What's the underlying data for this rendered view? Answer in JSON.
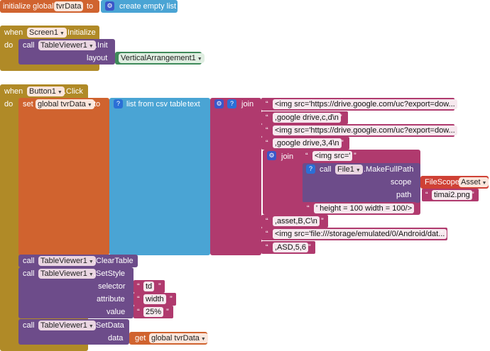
{
  "colors": {
    "global_orange": "#d0632f",
    "event_gold": "#b08a27",
    "list_blue": "#4aa4d4",
    "text_magenta": "#b03a6e",
    "component_purple": "#6d4c8a",
    "layout_green": "#3f8a5a"
  },
  "init_global": {
    "label": "initialize global",
    "name": "tvrData",
    "to": "to",
    "value_label": "create empty list"
  },
  "screen_init": {
    "when": "when",
    "component": "Screen1",
    "event": ".Initialize",
    "do": "do",
    "call": "call",
    "viewer": "TableViewer1",
    "method": ".Init",
    "layout_label": "layout",
    "layout_value": "VerticalArrangement1"
  },
  "button_click": {
    "when": "when",
    "component": "Button1",
    "event": ".Click",
    "do": "do",
    "set": "set",
    "var": "global tvrData",
    "to": "to",
    "list_from_csv": "list from csv table",
    "text": "text",
    "join": "join",
    "strings": [
      "<img src='https://drive.google.com/uc?export=dow...",
      ",google drive,c,d\\n",
      "<img src='https://drive.google.com/uc?export=dow...",
      ",google drive,3,4\\n"
    ],
    "inner_join": "join",
    "inner_str": "<img src='",
    "call_file": "call",
    "file": "File1",
    "make_full_path": ".MakeFullPath",
    "scope_label": "scope",
    "filescope": "FileScope",
    "filescope_value": "Asset",
    "path_label": "path",
    "path_value": "timai2.png",
    "height_str": "' height = 100 width = 100/>",
    "strings2": [
      ",asset,B,C\\n",
      "<img src='file:///storage/emulated/0/Android/dat...",
      ",ASD,5,6"
    ],
    "clear": {
      "call": "call",
      "viewer": "TableViewer1",
      "method": ".ClearTable"
    },
    "setstyle": {
      "call": "call",
      "viewer": "TableViewer1",
      "method": ".SetStyle",
      "selector_label": "selector",
      "selector": "td",
      "attribute_label": "attribute",
      "attribute": "width",
      "value_label": "value",
      "value": "25%"
    },
    "setdata": {
      "call": "call",
      "viewer": "TableViewer1",
      "method": ".SetData",
      "data_label": "data",
      "get": "get",
      "get_var": "global tvrData"
    }
  }
}
